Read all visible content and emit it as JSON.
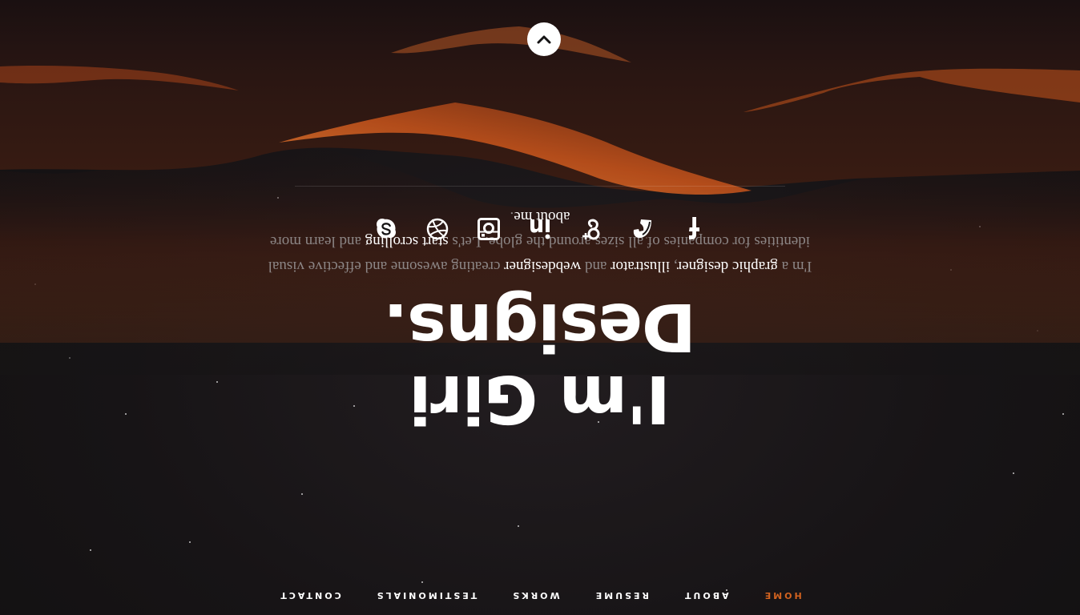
{
  "nav": {
    "items": [
      {
        "label": "HOME",
        "active": true
      },
      {
        "label": "ABOUT",
        "active": false
      },
      {
        "label": "RESUME",
        "active": false
      },
      {
        "label": "WORKS",
        "active": false
      },
      {
        "label": "TESTIMONIALS",
        "active": false
      },
      {
        "label": "CONTACT",
        "active": false
      }
    ],
    "active_color": "#d2621f"
  },
  "intro": {
    "heading": "I'm Giri Designs.",
    "p_1": "I'm a ",
    "h_graphic": "graphic designer",
    "p_2": ", ",
    "h_illustrator": "illustrator",
    "p_3": " and ",
    "h_webdesigner": "webdesigner",
    "p_4": " creating awesome and effective visual identities for companies of all sizes around the globe. Let's ",
    "h_scrolling": "start scrolling",
    "p_5": " and learn more ",
    "h_about": "about me",
    "p_6": "."
  },
  "social": [
    {
      "icon": "facebook-icon"
    },
    {
      "icon": "spartan-helmet-icon"
    },
    {
      "icon": "google-plus-icon"
    },
    {
      "icon": "linkedin-icon"
    },
    {
      "icon": "instagram-icon"
    },
    {
      "icon": "dribbble-icon"
    },
    {
      "icon": "skype-icon"
    }
  ],
  "scroll_button": {
    "icon": "chevron-down-icon"
  },
  "colors": {
    "accent": "#d2621f",
    "background": "#161415",
    "dune": "#e0722a"
  }
}
